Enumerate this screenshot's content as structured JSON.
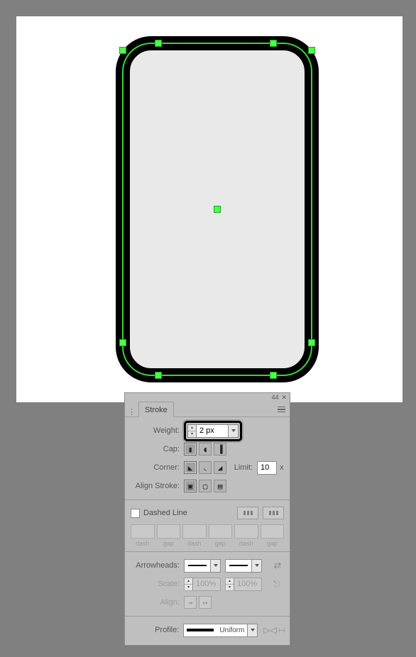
{
  "panel": {
    "tab_label": "Stroke",
    "weight_label": "Weight:",
    "weight_value": "2 px",
    "cap_label": "Cap:",
    "corner_label": "Corner:",
    "limit_label": "Limit:",
    "limit_value": "10",
    "limit_unit": "x",
    "align_stroke_label": "Align Stroke:",
    "dashed_label": "Dashed Line",
    "dash_caption": "dash",
    "gap_caption": "gap",
    "arrowheads_label": "Arrowheads:",
    "scale_label": "Scale:",
    "scale_value_a": "100%",
    "scale_value_b": "100%",
    "align_arrow_label": "Align:",
    "profile_label": "Profile:",
    "profile_value": "Uniform"
  },
  "shape": {
    "corner_radius": 40,
    "stroke_px": 20
  }
}
